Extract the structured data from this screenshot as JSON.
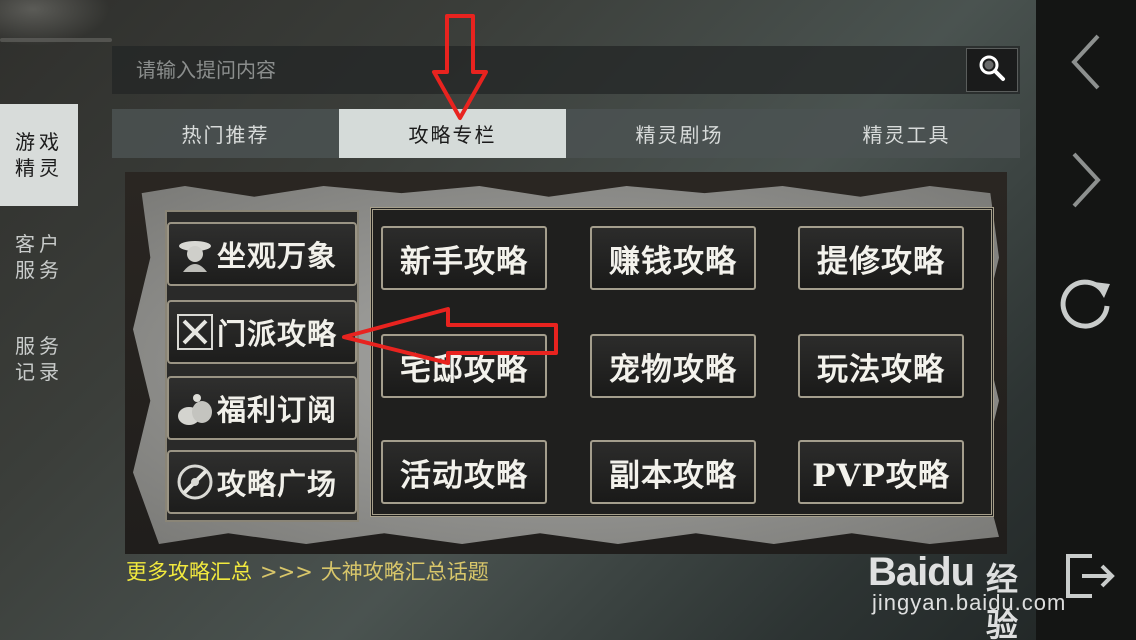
{
  "left_nav": {
    "items": [
      {
        "label": "游戏\n精灵",
        "active": true
      },
      {
        "label": "客户\n服务",
        "active": false
      },
      {
        "label": "服务\n记录",
        "active": false
      }
    ]
  },
  "search": {
    "placeholder": "请输入提问内容",
    "icon": "search-icon"
  },
  "tabs": [
    {
      "label": "热门推荐",
      "active": false
    },
    {
      "label": "攻略专栏",
      "active": true
    },
    {
      "label": "精灵剧场",
      "active": false
    },
    {
      "label": "精灵工具",
      "active": false
    }
  ],
  "banner": {
    "side_buttons": [
      {
        "label": "坐观万象",
        "icon": "sage-icon"
      },
      {
        "label": "门派攻略",
        "icon": "crossed-swords-icon"
      },
      {
        "label": "福利订阅",
        "icon": "money-bag-icon"
      },
      {
        "label": "攻略广场",
        "icon": "compass-icon"
      }
    ],
    "grid_buttons": [
      "新手攻略",
      "赚钱攻略",
      "提修攻略",
      "宅邸攻略",
      "宠物攻略",
      "玩法攻略",
      "活动攻略",
      "副本攻略",
      "PVP攻略"
    ]
  },
  "footer": {
    "more_link": "更多攻略汇总",
    "separator": ">>>",
    "topic_link": "大神攻略汇总话题"
  },
  "right_nav": {
    "back_icon": "chevron-left-icon",
    "forward_icon": "chevron-right-icon",
    "refresh_icon": "refresh-icon",
    "exit_icon": "exit-icon"
  },
  "watermark": {
    "logo": "Baidu",
    "cn": "经验",
    "url": "jingyan.baidu.com"
  },
  "colors": {
    "active_tab_bg": "#d5dbd9",
    "footer_link": "#f1e93e",
    "annotation_arrow": "#e8231f"
  }
}
